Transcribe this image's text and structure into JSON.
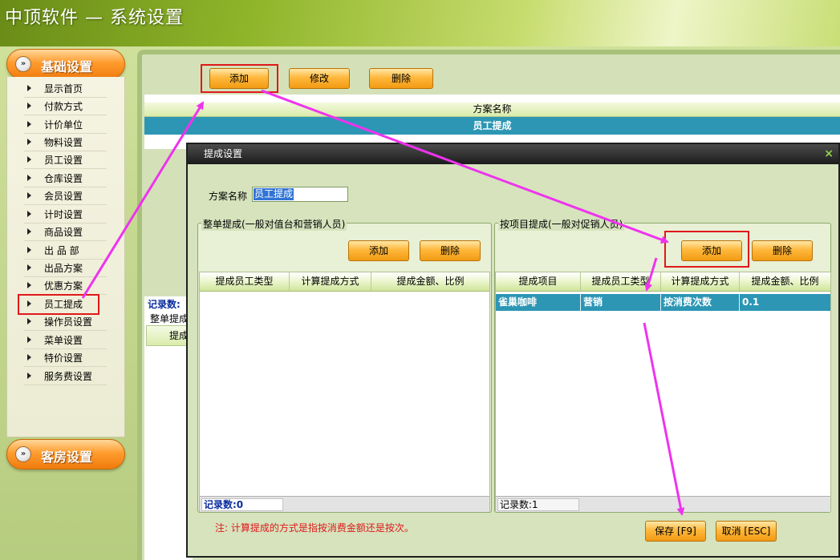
{
  "app": {
    "title": "中顶软件 — 系统设置"
  },
  "sidebar": {
    "header_basic": "基础设置",
    "header_room": "客房设置",
    "items": [
      {
        "label": "显示首页"
      },
      {
        "label": "付款方式"
      },
      {
        "label": "计价单位"
      },
      {
        "label": "物料设置"
      },
      {
        "label": "员工设置"
      },
      {
        "label": "仓库设置"
      },
      {
        "label": "会员设置"
      },
      {
        "label": "计时设置"
      },
      {
        "label": "商品设置"
      },
      {
        "label": "出 品 部"
      },
      {
        "label": "出品方案"
      },
      {
        "label": "优惠方案"
      },
      {
        "label": "员工提成",
        "selected": true
      },
      {
        "label": "操作员设置"
      },
      {
        "label": "菜单设置"
      },
      {
        "label": "特价设置"
      },
      {
        "label": "服务费设置"
      }
    ]
  },
  "main": {
    "toolbar": {
      "add_label": "添加",
      "edit_label": "修改",
      "delete_label": "删除"
    },
    "table": {
      "column_header": "方案名称",
      "selected_row": "员工提成"
    },
    "records_label": "记录数:",
    "whole_label_partial": "整单提成",
    "sub_header_partial": "提成"
  },
  "dialog": {
    "title": "提成设置",
    "close_glyph": "×",
    "scheme_label": "方案名称",
    "scheme_value": "员工提成",
    "whole_group": {
      "legend": "整单提成(一般对值台和营销人员)",
      "add_label": "添加",
      "delete_label": "删除",
      "columns": [
        "提成员工类型",
        "计算提成方式",
        "提成金额、比例"
      ],
      "status": "记录数:0"
    },
    "item_group": {
      "legend": "按项目提成(一般对促销人员)",
      "add_label": "添加",
      "delete_label": "删除",
      "columns": [
        "提成项目",
        "提成员工类型",
        "计算提成方式",
        "提成金额、比例"
      ],
      "rows": [
        {
          "item": "雀巢咖啡",
          "employee_type": "营销",
          "method": "按消费次数",
          "amount": "0.1"
        }
      ],
      "status": "记录数:1"
    },
    "note": "注: 计算提成的方式是指按消费金额还是按次。",
    "save_label": "保存 [F9]",
    "cancel_label": "取消 [ESC]"
  },
  "colors": {
    "accent_orange": "#ffb83c",
    "selected_row": "#2c96b4",
    "annotation_red": "#e0191b",
    "annotation_arrow": "#ee33ee"
  }
}
